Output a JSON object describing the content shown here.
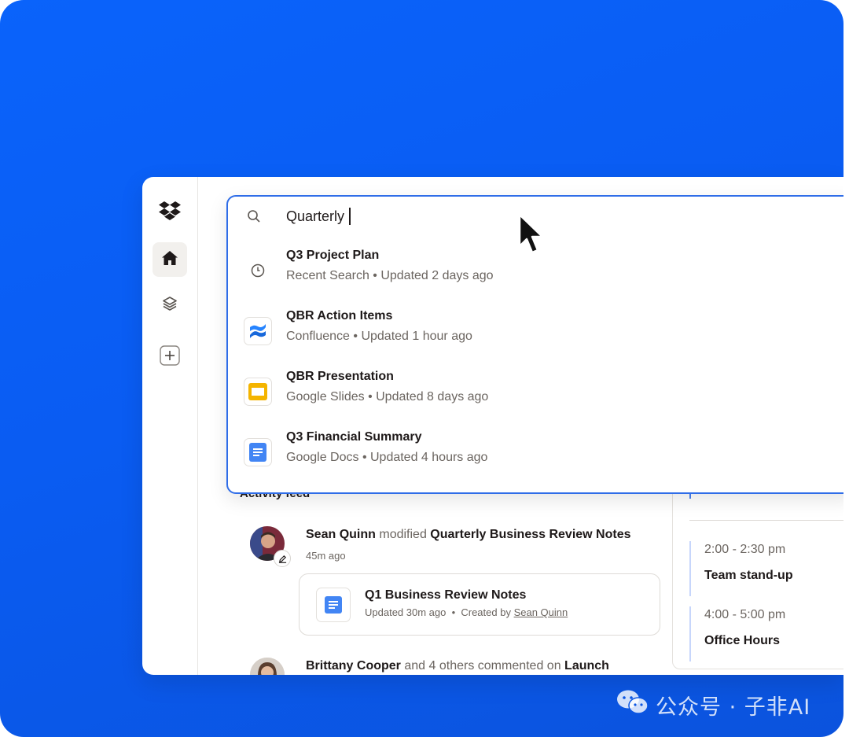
{
  "search": {
    "query": "Quarterly",
    "results": [
      {
        "title": "Q3 Project Plan",
        "meta": "Recent Search • Updated 2 days ago",
        "icon": "clock-icon"
      },
      {
        "title": "QBR Action Items",
        "meta": "Confluence • Updated 1 hour ago",
        "icon": "confluence-icon"
      },
      {
        "title": "QBR Presentation",
        "meta": "Google Slides • Updated 8 days ago",
        "icon": "google-slides-icon"
      },
      {
        "title": "Q3 Financial Summary",
        "meta": "Google Docs • Updated 4 hours ago",
        "icon": "google-docs-icon"
      }
    ]
  },
  "sidebar": {
    "items": [
      {
        "icon": "dropbox-logo-icon"
      },
      {
        "icon": "home-icon",
        "active": true
      },
      {
        "icon": "layers-icon"
      },
      {
        "icon": "plus-icon"
      }
    ]
  },
  "activity": {
    "title": "Activity feed",
    "items": [
      {
        "user": "Sean Quinn",
        "action": "modified",
        "target": "Quarterly Business Review Notes",
        "time": "45m ago",
        "card": {
          "title": "Q1 Business Review Notes",
          "meta_prefix": "Updated 30m ago  •  Created by",
          "creator": "Sean Quinn"
        }
      },
      {
        "user": "Brittany Cooper",
        "action": "and 4 others commented on",
        "target": "Launch"
      }
    ]
  },
  "calendar": {
    "events": [
      {
        "time": "2:00 - 2:30 pm",
        "name": "Team stand-up"
      },
      {
        "time": "4:00 - 5:00 pm",
        "name": "Office Hours"
      }
    ]
  },
  "watermark": {
    "text": "公众号 · 子非AI"
  },
  "colors": {
    "background_blue": "#0a5cf2",
    "search_border": "#2f6de8",
    "docs_blue": "#4285f4",
    "slides_yellow": "#f4b400",
    "confluence_blue": "#1868db"
  }
}
